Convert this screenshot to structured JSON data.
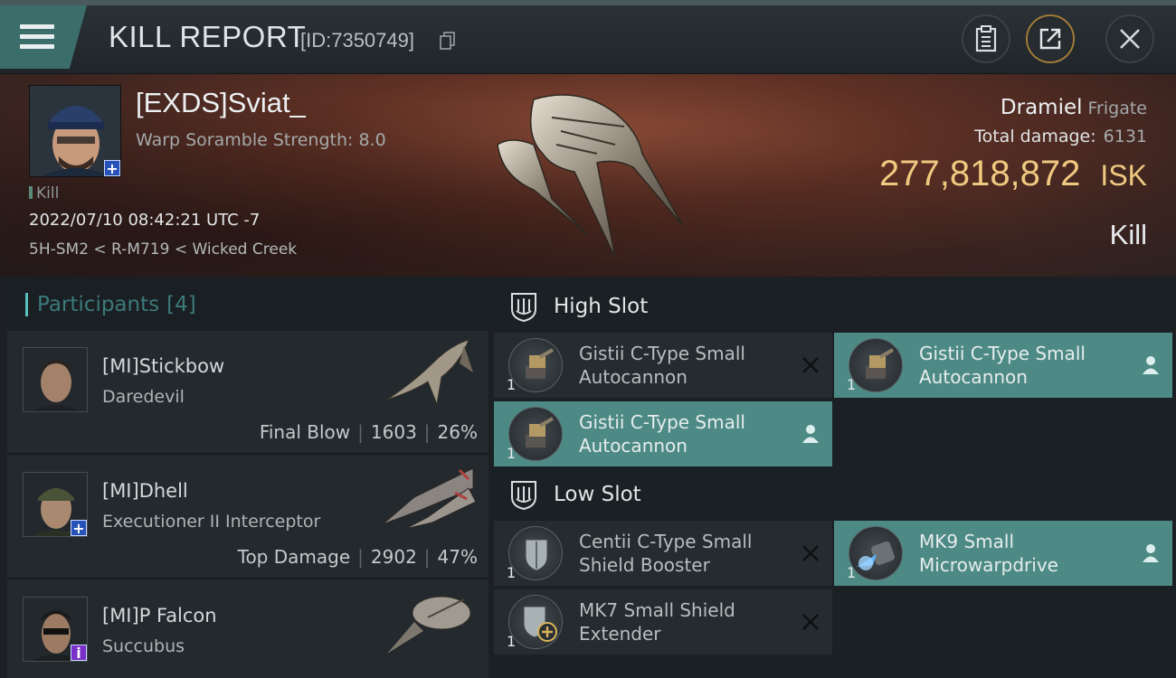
{
  "header": {
    "title": "KILL REPORT",
    "report_id": "[ID:7350749]",
    "menu_icon": "hamburger-menu-icon",
    "buttons": [
      "clipboard-icon",
      "share-icon",
      "close-icon"
    ]
  },
  "victim": {
    "name": "[EXDS]Sviat_",
    "warp_scramble": "Warp Soramble Strength: 8.0",
    "tag": "Kill",
    "datetime": "2022/07/10 08:42:21 UTC -7",
    "location": "5H-SM2 < R-M719 < Wicked Creek",
    "ship_name": "Dramiel",
    "ship_class": "Frigate",
    "total_damage_label": "Total damage:",
    "total_damage": "6131",
    "isk_value": "277,818,872",
    "isk_unit": "ISK",
    "result": "Kill"
  },
  "participants": {
    "title": "Participants",
    "count": "[4]",
    "rows": [
      {
        "name": "[MI]Stickbow",
        "ship": "Daredevil",
        "role": "Final Blow",
        "damage": "1603",
        "percent": "26%"
      },
      {
        "name": "[MI]Dhell",
        "ship": "Executioner II Interceptor",
        "role": "Top Damage",
        "damage": "2902",
        "percent": "47%"
      },
      {
        "name": "[MI]P Falcon",
        "ship": "Succubus"
      }
    ]
  },
  "slots": {
    "high": {
      "title": "High Slot",
      "modules": [
        {
          "name": "Gistii C-Type Small Autocannon",
          "qty": "1"
        },
        {
          "name": "Gistii C-Type Small Autocannon",
          "qty": "1"
        },
        {
          "name": "Gistii C-Type Small Autocannon",
          "qty": "1"
        }
      ]
    },
    "low": {
      "title": "Low Slot",
      "modules": [
        {
          "name": "Centii C-Type Small Shield Booster",
          "qty": "1"
        },
        {
          "name": "MK9 Small Microwarpdrive",
          "qty": "1"
        },
        {
          "name": "MK7 Small Shield Extender",
          "qty": "1"
        }
      ]
    }
  },
  "colors": {
    "accent_teal": "#4d8a85",
    "isk_gold": "#efc980",
    "banner_red": "#5e3024"
  }
}
